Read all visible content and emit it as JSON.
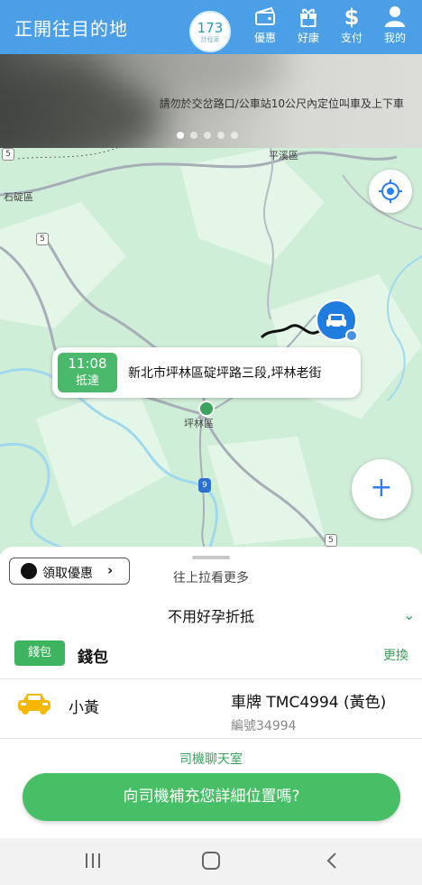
{
  "header": {
    "title": "正開往目的地",
    "logo": {
      "number": "173",
      "sub": "計程車"
    },
    "nav": [
      {
        "label": "優惠",
        "icon": "coupon-icon"
      },
      {
        "label": "好康",
        "icon": "gift-icon"
      },
      {
        "label": "支付",
        "icon": "dollar-icon"
      },
      {
        "label": "我的",
        "icon": "person-icon"
      }
    ]
  },
  "banner": {
    "notice": "請勿於交岔路口/公車站10公尺內定位叫車及上下車",
    "page_count": 5,
    "active_page": 1
  },
  "map": {
    "labels": {
      "shiding": "石碇區",
      "pinglin": "坪林區",
      "pingxi": "平溪區",
      "road5a": "5",
      "road5b": "5",
      "road5c": "5",
      "road9": "9"
    },
    "callout": {
      "time": "11:08",
      "status": "抵達",
      "address": "新北市坪林區碇坪路三段,坪林老街"
    }
  },
  "sheet": {
    "coupon_label": "領取優惠",
    "coupon_chevron": "›",
    "pull_hint": "往上拉看更多",
    "option": "不用好孕折抵",
    "option_chevron": "⌄",
    "wallet_tag": "錢包",
    "wallet_label": "錢包",
    "change_label": "更換",
    "car_type": "小黃",
    "plate": "車牌 TMC4994 (黃色)",
    "serial": "編號34994",
    "chat_link": "司機聊天室",
    "cta": "向司機補充您詳細位置嗎?"
  },
  "colors": {
    "header": "#4a9fe6",
    "accent_green": "#47bf66",
    "map_bg": "#cfeed8",
    "pin_blue": "#1f7de0"
  }
}
